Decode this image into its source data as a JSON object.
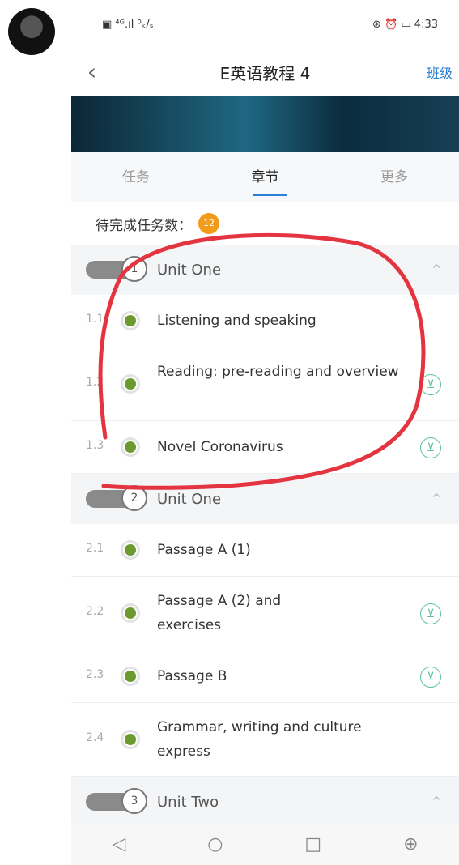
{
  "status_bar": {
    "left": "▣ ⁴ᴳ.ıl ⁰ₖ/ₛ",
    "right": "⊛ ⏰ ▭ 4:33"
  },
  "header": {
    "back_icon": "‹",
    "title": "E英语教程 4",
    "right": "班级"
  },
  "tabs": [
    {
      "label": "任务"
    },
    {
      "label": "章节"
    },
    {
      "label": "更多"
    }
  ],
  "pending": {
    "label": "待完成任务数：",
    "count": "12"
  },
  "units": [
    {
      "num": "1",
      "title": "Unit One",
      "items": [
        {
          "num": "1.1",
          "label": "Listening and speaking",
          "download": false
        },
        {
          "num": "1.2",
          "label": "Reading: pre-reading and overview",
          "download": true
        },
        {
          "num": "1.3",
          "label": "Novel Coronavirus",
          "download": true
        }
      ]
    },
    {
      "num": "2",
      "title": "Unit One",
      "items": [
        {
          "num": "2.1",
          "label": "Passage A (1)",
          "download": false
        },
        {
          "num": "2.2",
          "label": "Passage A (2) and exercises",
          "download": true
        },
        {
          "num": "2.3",
          "label": "Passage B",
          "download": true
        },
        {
          "num": "2.4",
          "label": "Grammar, writing and culture express",
          "download": false
        }
      ]
    },
    {
      "num": "3",
      "title": "Unit Two",
      "items": []
    }
  ],
  "bottom_nav": {
    "back": "◁",
    "home": "○",
    "recent": "□",
    "zoom": "⊕"
  },
  "icons": {
    "caret": "^",
    "download": "⊻"
  }
}
